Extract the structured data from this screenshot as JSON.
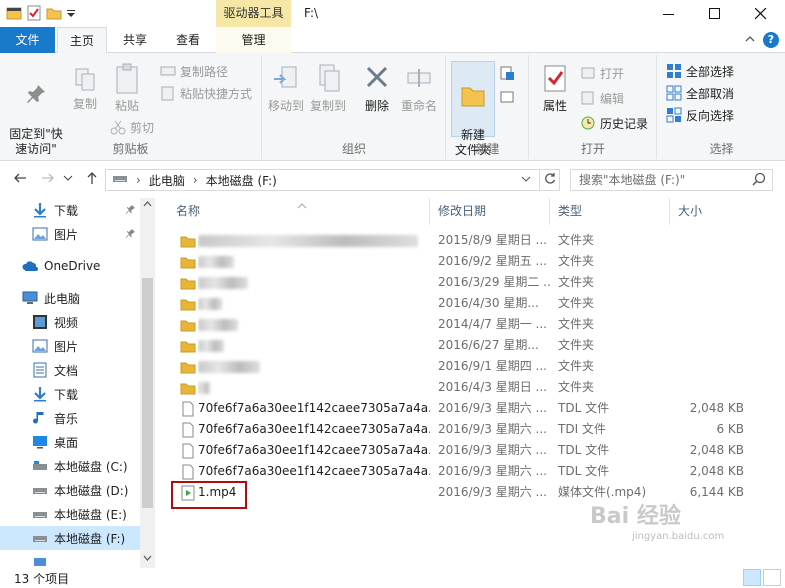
{
  "window": {
    "context_tab_title": "驱动器工具",
    "title": "F:\\"
  },
  "tabs": {
    "file": "文件",
    "home": "主页",
    "share": "共享",
    "view": "查看",
    "manage": "管理"
  },
  "ribbon": {
    "clipboard": {
      "label": "剪贴板",
      "pin": "固定到\"快\n速访问\"",
      "copy": "复制",
      "paste": "粘贴",
      "copy_path": "复制路径",
      "paste_shortcut": "粘贴快捷方式",
      "cut": "剪切"
    },
    "organize": {
      "label": "组织",
      "move_to": "移动到",
      "copy_to": "复制到",
      "delete": "删除",
      "rename": "重命名"
    },
    "new": {
      "label": "新建",
      "new_folder": "新建\n文件夹"
    },
    "open": {
      "label": "打开",
      "properties": "属性",
      "open": "打开",
      "edit": "编辑",
      "history": "历史记录"
    },
    "select": {
      "label": "选择",
      "select_all": "全部选择",
      "select_none": "全部取消",
      "invert": "反向选择"
    }
  },
  "address": {
    "crumbs": [
      "此电脑",
      "本地磁盘 (F:)"
    ],
    "search_placeholder": "搜索\"本地磁盘 (F:)\""
  },
  "nav": {
    "items": [
      {
        "label": "下载",
        "icon": "download-icon",
        "pinned": true
      },
      {
        "label": "图片",
        "icon": "pictures-icon",
        "pinned": true
      },
      {
        "label": "OneDrive",
        "icon": "onedrive-icon"
      },
      {
        "label": "此电脑",
        "icon": "this-pc-icon"
      },
      {
        "label": "视频",
        "icon": "videos-icon"
      },
      {
        "label": "图片",
        "icon": "pictures-icon"
      },
      {
        "label": "文档",
        "icon": "documents-icon"
      },
      {
        "label": "下载",
        "icon": "download-icon"
      },
      {
        "label": "音乐",
        "icon": "music-icon"
      },
      {
        "label": "桌面",
        "icon": "desktop-icon"
      },
      {
        "label": "本地磁盘 (C:)",
        "icon": "drive-icon"
      },
      {
        "label": "本地磁盘 (D:)",
        "icon": "drive-icon"
      },
      {
        "label": "本地磁盘 (E:)",
        "icon": "drive-icon"
      },
      {
        "label": "本地磁盘 (F:)",
        "icon": "drive-icon",
        "selected": true
      }
    ]
  },
  "columns": {
    "name": "名称",
    "date": "修改日期",
    "type": "类型",
    "size": "大小"
  },
  "files": [
    {
      "name": "",
      "blurred": true,
      "date": "2015/8/9 星期日 ...",
      "type": "文件夹",
      "size": "",
      "kind": "folder"
    },
    {
      "name": "",
      "blurred": true,
      "date": "2016/9/2 星期五 ...",
      "type": "文件夹",
      "size": "",
      "kind": "folder"
    },
    {
      "name": "",
      "blurred": true,
      "date": "2016/3/29 星期二 ...",
      "type": "文件夹",
      "size": "",
      "kind": "folder"
    },
    {
      "name": "",
      "blurred": true,
      "date": "2016/4/30 星期...",
      "type": "文件夹",
      "size": "",
      "kind": "folder"
    },
    {
      "name": "",
      "blurred": true,
      "date": "2014/4/7 星期一 ...",
      "type": "文件夹",
      "size": "",
      "kind": "folder"
    },
    {
      "name": "",
      "blurred": true,
      "date": "2016/6/27 星期...",
      "type": "文件夹",
      "size": "",
      "kind": "folder"
    },
    {
      "name": "",
      "blurred": true,
      "date": "2016/9/1 星期四 ...",
      "type": "文件夹",
      "size": "",
      "kind": "folder"
    },
    {
      "name": "",
      "blurred": true,
      "date": "2016/4/3 星期日 ...",
      "type": "文件夹",
      "size": "",
      "kind": "folder"
    },
    {
      "name": "70fe6f7a6a30ee1f142caee7305a7a4a....",
      "date": "2016/9/3 星期六 ...",
      "type": "TDL 文件",
      "size": "2,048 KB",
      "kind": "file"
    },
    {
      "name": "70fe6f7a6a30ee1f142caee7305a7a4a....",
      "date": "2016/9/3 星期六 ...",
      "type": "TDI 文件",
      "size": "6 KB",
      "kind": "file"
    },
    {
      "name": "70fe6f7a6a30ee1f142caee7305a7a4a....",
      "date": "2016/9/3 星期六 ...",
      "type": "TDL 文件",
      "size": "2,048 KB",
      "kind": "file"
    },
    {
      "name": "70fe6f7a6a30ee1f142caee7305a7a4a....",
      "date": "2016/9/3 星期六 ...",
      "type": "TDL 文件",
      "size": "2,048 KB",
      "kind": "file"
    },
    {
      "name": "1.mp4",
      "date": "2016/9/3 星期六 ...",
      "type": "媒体文件(.mp4)",
      "size": "6,144 KB",
      "kind": "media"
    }
  ],
  "status": {
    "count": "13 个项目"
  },
  "watermark": {
    "text": "Bai 经验",
    "url": "jingyan.baidu.com"
  },
  "colors": {
    "accent": "#1979ca",
    "folder": "#e8b537",
    "selected": "#cce8ff",
    "highlight_box": "#b00d0d"
  }
}
